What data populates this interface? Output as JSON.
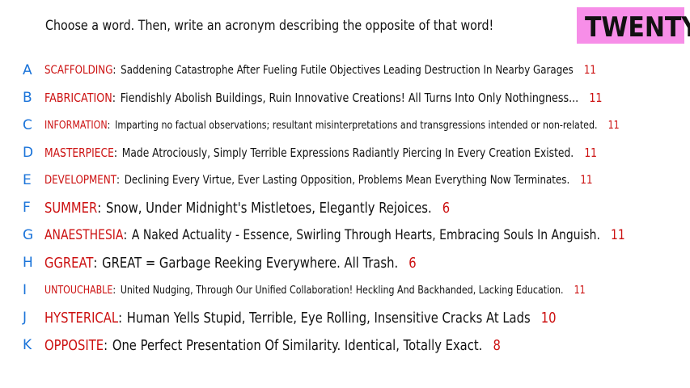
{
  "header": {
    "prompt": "Choose a word. Then, write an acronym describing the opposite of that word!",
    "badge": "TWENTY",
    "badge_color": "#f78ee8"
  },
  "colors": {
    "letter": "#1a73d9",
    "word": "#cc1111",
    "count": "#cc1111"
  },
  "entries": [
    {
      "letter": "A",
      "word": "SCAFFOLDING",
      "acronym": "Saddening Catastrophe After Fueling Futile Objectives Leading Destruction In Nearby Garages",
      "count": "11"
    },
    {
      "letter": "B",
      "word": "FABRICATION",
      "acronym": "Fiendishly Abolish Buildings, Ruin Innovative Creations! All Turns Into Only Nothingness...",
      "count": "11"
    },
    {
      "letter": "C",
      "word": "INFORMATION",
      "acronym": "Imparting no factual observations; resultant misinterpretations and transgressions intended or non-related.",
      "count": "11"
    },
    {
      "letter": "D",
      "word": "MASTERPIECE",
      "acronym": "Made Atrociously, Simply Terrible Expressions Radiantly Piercing In Every Creation Existed.",
      "count": "11"
    },
    {
      "letter": "E",
      "word": "DEVELOPMENT",
      "acronym": "Declining Every Virtue, Ever Lasting Opposition, Problems Mean Everything Now Terminates.",
      "count": "11"
    },
    {
      "letter": "F",
      "word": "SUMMER",
      "acronym": "Snow, Under Midnight's Mistletoes, Elegantly Rejoices.",
      "count": "6"
    },
    {
      "letter": "G",
      "word": "ANAESTHESIA",
      "acronym": "A Naked Actuality - Essence, Swirling Through Hearts, Embracing Souls In Anguish.",
      "count": "11"
    },
    {
      "letter": "H",
      "word": "GGREAT",
      "acronym": "GREAT = Garbage Reeking Everywhere. All Trash.",
      "count": "6"
    },
    {
      "letter": "I",
      "word": "UNTOUCHABLE",
      "acronym": "United Nudging, Through Our Unified Collaboration! Heckling And Backhanded, Lacking Education.",
      "count": "11"
    },
    {
      "letter": "J",
      "word": "HYSTERICAL",
      "acronym": "Human Yells Stupid, Terrible, Eye Rolling, Insensitive Cracks At Lads",
      "count": "10"
    },
    {
      "letter": "K",
      "word": "OPPOSITE",
      "acronym": "One Perfect Presentation Of Similarity. Identical, Totally Exact.",
      "count": "8"
    }
  ]
}
